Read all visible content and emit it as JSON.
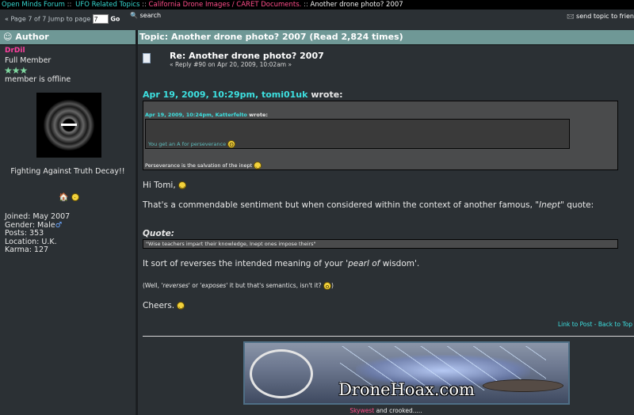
{
  "breadcrumb": {
    "items": [
      "Open Minds Forum",
      "UFO Related Topics",
      "California Drone Images / CARET Documents."
    ],
    "current": "Another drone photo? 2007",
    "separator": " :: "
  },
  "nav": {
    "pages_text": "« Page 7 of 7 Jump to page",
    "page_value": "7",
    "go_label": "Go",
    "search_label": "search",
    "send_topic_label": "send topic to frien"
  },
  "author_header": "Author",
  "topic_header": "Topic: Another drone photo? 2007  (Read 2,824 times)",
  "author": {
    "username": "DrDil",
    "rank": "Full Member",
    "stars": "★★★",
    "status": "member is offline",
    "motto": "Fighting Against Truth Decay!!",
    "stats": [
      "Joined: May 2007",
      "Gender: Male",
      "Posts: 353",
      "Location: U.K.",
      "Karma: 127"
    ]
  },
  "post": {
    "title": "Re: Another drone photo? 2007",
    "meta": "« Reply #90 on Apr 20, 2009, 10:02am »",
    "quote1_header_date": "Apr 19, 2009, 10:29pm",
    "quote1_header_name": "tomi01uk",
    "quote1_header_suffix": "wrote:",
    "quote2_header_date": "Apr 19, 2009, 10:24pm",
    "quote2_header_name": "Katterfelto",
    "quote2_header_suffix": "wrote:",
    "quote2_text": "You get an A for perseverance",
    "quote1_text": "Perseverance is the salvation of the inept",
    "greeting": "Hi Tomi,",
    "para1_pre": "That's a commendable sentiment but when considered within the context of another famous, \"",
    "para1_em": "Inept",
    "para1_post": "\" quote:",
    "quote_label": "Quote:",
    "quote3_text": "\"Wise teachers impart their knowledge, Inept ones impose theirs\"",
    "para2_pre": "It sort of reverses the intended meaning of your ",
    "para2_em": "'pearl of",
    "para2_post": " wisdom'.",
    "note_open": "(Well, ",
    "note_em1": "'reverses'",
    "note_mid": " or ",
    "note_em2": "'exposes'",
    "note_rest": " it but that's semantics, isn't it? ",
    "note_close": ")",
    "closing": "Cheers.",
    "link_post": "Link to Post",
    "link_sep": " - ",
    "link_top": "Back to Top"
  },
  "signature": {
    "banner_text": "DroneHoax.com",
    "name": "Skywest",
    "rest": " and crooked....."
  }
}
